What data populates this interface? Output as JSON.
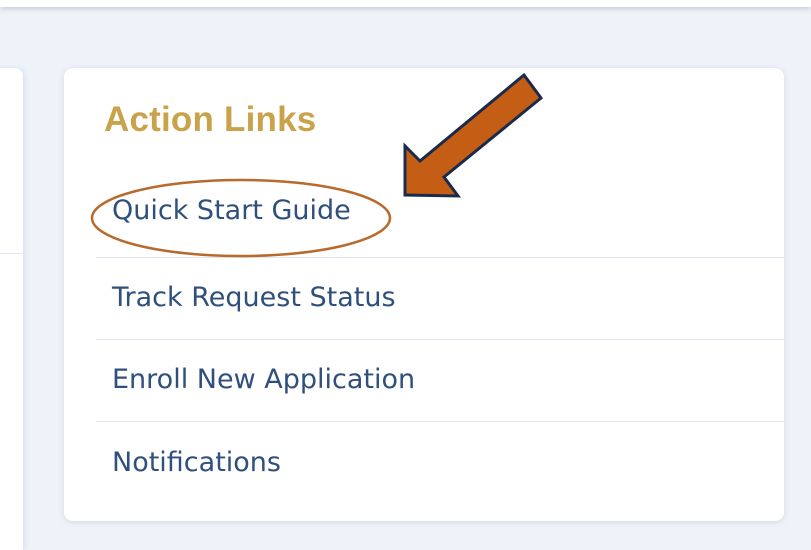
{
  "action_links": {
    "title": "Action Links",
    "items": [
      {
        "label": "Quick Start Guide"
      },
      {
        "label": "Track Request Status"
      },
      {
        "label": "Enroll New Application"
      },
      {
        "label": "Notifications"
      }
    ]
  },
  "colors": {
    "title": "#c9a24a",
    "link": "#2f4f7c",
    "annotation_fill": "#c45e14",
    "annotation_outline": "#1b2a4a",
    "annotation_circle": "#b86a2c",
    "background": "#eef2f9"
  }
}
